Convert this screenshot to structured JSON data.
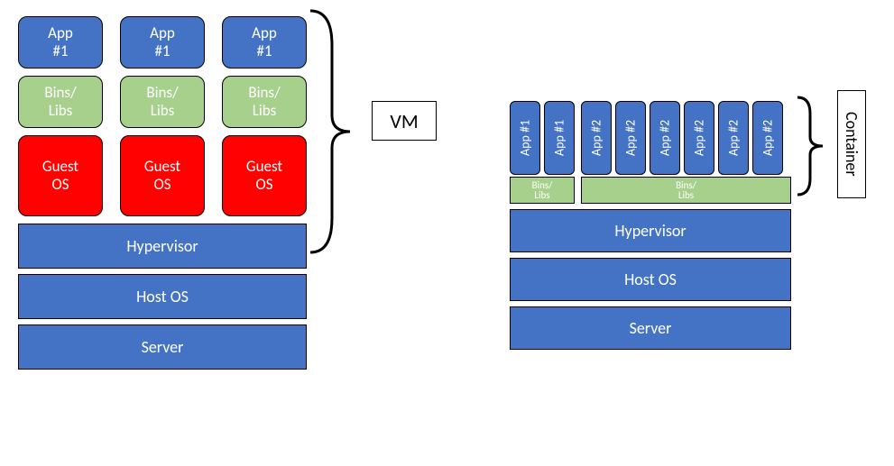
{
  "vm": {
    "columns": [
      {
        "app": "App\n#1",
        "bins": "Bins/\nLibs",
        "guest": "Guest\nOS"
      },
      {
        "app": "App\n#1",
        "bins": "Bins/\nLibs",
        "guest": "Guest\nOS"
      },
      {
        "app": "App\n#1",
        "bins": "Bins/\nLibs",
        "guest": "Guest\nOS"
      }
    ],
    "base": {
      "hypervisor": "Hypervisor",
      "host_os": "Host OS",
      "server": "Server"
    },
    "brace_label": "VM"
  },
  "container": {
    "group1_apps": [
      "App #1",
      "App #1"
    ],
    "group2_apps": [
      "App #2",
      "App #2",
      "App #2",
      "App #2",
      "App #2",
      "App #2"
    ],
    "bins_a": "Bins/\nLibs",
    "bins_b": "Bins/\nLibs",
    "base": {
      "hypervisor": "Hypervisor",
      "host_os": "Host OS",
      "server": "Server"
    },
    "brace_label": "Container"
  },
  "colors": {
    "blue": "#4473c5",
    "green": "#a8d08d",
    "red": "#ff0100"
  },
  "chart_data": {
    "type": "diagram",
    "title": "VM vs Container architecture comparison",
    "left": {
      "label": "VM",
      "stacks_bottom_to_top": [
        "Server",
        "Host OS",
        "Hypervisor"
      ],
      "per_vm_layers_bottom_to_top": [
        "Guest OS",
        "Bins/Libs",
        "App"
      ],
      "vm_count": 3,
      "app_labels": [
        "App #1",
        "App #1",
        "App #1"
      ]
    },
    "right": {
      "label": "Container",
      "stacks_bottom_to_top": [
        "Server",
        "Host OS",
        "Hypervisor"
      ],
      "shared_layers": [
        "Bins/Libs"
      ],
      "bins_groups": 2,
      "apps": [
        {
          "bins_group": 1,
          "apps": [
            "App #1",
            "App #1"
          ]
        },
        {
          "bins_group": 2,
          "apps": [
            "App #2",
            "App #2",
            "App #2",
            "App #2",
            "App #2",
            "App #2"
          ]
        }
      ],
      "container_count": 8
    }
  }
}
